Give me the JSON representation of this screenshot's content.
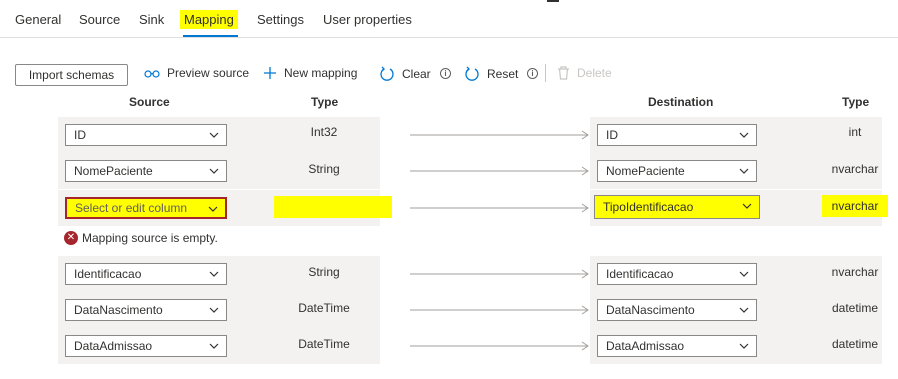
{
  "tabs": [
    "General",
    "Source",
    "Sink",
    "Mapping",
    "Settings",
    "User properties"
  ],
  "toolbar": {
    "import": "Import schemas",
    "preview": "Preview source",
    "new_mapping": "New mapping",
    "clear": "Clear",
    "reset": "Reset",
    "delete": "Delete"
  },
  "headers": {
    "source": "Source",
    "type": "Type",
    "destination": "Destination",
    "type2": "Type"
  },
  "rows": [
    {
      "source": "ID",
      "src_type": "Int32",
      "destination": "ID",
      "dst_type": "int"
    },
    {
      "source": "NomePaciente",
      "src_type": "String",
      "destination": "NomePaciente",
      "dst_type": "nvarchar"
    },
    {
      "source": "Select or edit column",
      "src_type": "",
      "destination": "TipoIdentificacao",
      "dst_type": "nvarchar"
    },
    {
      "source": "Identificacao",
      "src_type": "String",
      "destination": "Identificacao",
      "dst_type": "nvarchar"
    },
    {
      "source": "DataNascimento",
      "src_type": "DateTime",
      "destination": "DataNascimento",
      "dst_type": "datetime"
    },
    {
      "source": "DataAdmissao",
      "src_type": "DateTime",
      "destination": "DataAdmissao",
      "dst_type": "datetime"
    }
  ],
  "error": "Mapping source is empty.",
  "colors": {
    "accent": "#0078d4",
    "highlight": "#ffff00",
    "error": "#a4262c"
  }
}
